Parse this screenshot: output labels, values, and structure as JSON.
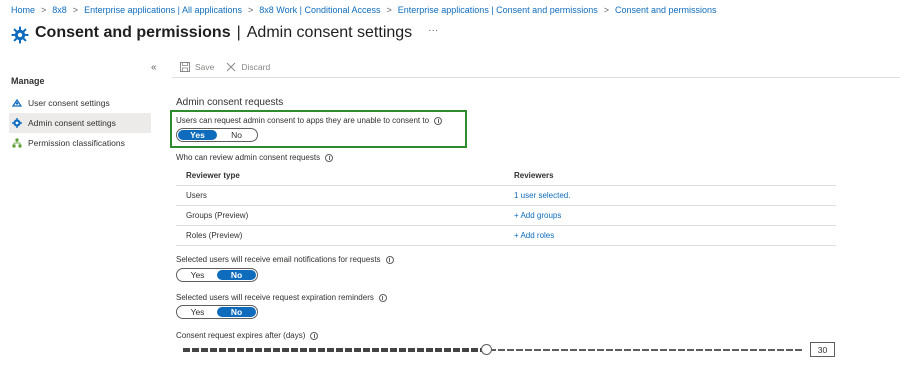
{
  "breadcrumb": [
    "Home",
    "8x8",
    "Enterprise applications | All applications",
    "8x8 Work | Conditional Access",
    "Enterprise applications | Consent and permissions",
    "Consent and permissions"
  ],
  "header": {
    "title": "Consent and permissions",
    "subtitle": "Admin consent settings",
    "more": "···"
  },
  "nav": {
    "collapse": "«",
    "section": "Manage",
    "items": [
      {
        "label": "User consent settings",
        "icon": "user-consent-icon"
      },
      {
        "label": "Admin consent settings",
        "icon": "gear-icon",
        "active": true
      },
      {
        "label": "Permission classifications",
        "icon": "hierarchy-icon"
      }
    ]
  },
  "toolbar": {
    "save": "Save",
    "discard": "Discard"
  },
  "main": {
    "section_title": "Admin consent requests",
    "request_label": "Users can request admin consent to apps they are unable to consent to",
    "request_toggle": {
      "yes": "Yes",
      "no": "No",
      "selected": "Yes"
    },
    "reviewers_label": "Who can review admin consent requests",
    "table": {
      "headers": [
        "Reviewer type",
        "Reviewers"
      ],
      "rows": [
        {
          "type": "Users",
          "value": "1 user selected."
        },
        {
          "type": "Groups (Preview)",
          "value": "+ Add groups"
        },
        {
          "type": "Roles (Preview)",
          "value": "+ Add roles"
        }
      ]
    },
    "email_label": "Selected users will receive email notifications for requests",
    "email_toggle": {
      "yes": "Yes",
      "no": "No",
      "selected": "No"
    },
    "reminder_label": "Selected users will receive request expiration reminders",
    "reminder_toggle": {
      "yes": "Yes",
      "no": "No",
      "selected": "No"
    },
    "expiry_label": "Consent request expires after (days)",
    "expiry_days": "30",
    "expiry_fraction": 0.49
  },
  "colors": {
    "accent": "#0f6cbd",
    "highlight": "#2e8b2e"
  }
}
